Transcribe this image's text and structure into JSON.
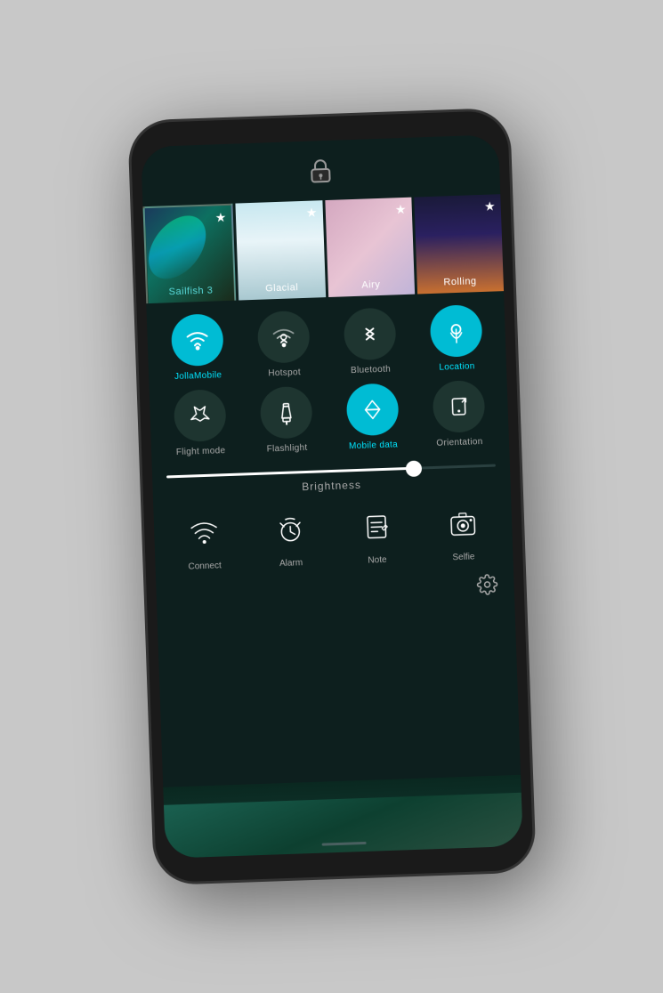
{
  "phone": {
    "lock_icon": "🔒"
  },
  "wallpapers": [
    {
      "label": "Sailfish 3",
      "active": true,
      "starred": true,
      "type": "sailfish"
    },
    {
      "label": "Glacial",
      "active": false,
      "starred": true,
      "type": "glacial"
    },
    {
      "label": "Airy",
      "active": false,
      "starred": true,
      "type": "airy"
    },
    {
      "label": "Rolling",
      "active": false,
      "starred": true,
      "type": "rolling"
    }
  ],
  "quick_toggles": [
    {
      "id": "wifi",
      "label": "JollaMobile",
      "active": true
    },
    {
      "id": "hotspot",
      "label": "Hotspot",
      "active": false
    },
    {
      "id": "bluetooth",
      "label": "Bluetooth",
      "active": false
    },
    {
      "id": "location",
      "label": "Location",
      "active": true
    },
    {
      "id": "flight",
      "label": "Flight mode",
      "active": false
    },
    {
      "id": "flashlight",
      "label": "Flashlight",
      "active": false
    },
    {
      "id": "mobiledata",
      "label": "Mobile data",
      "active": true
    },
    {
      "id": "orientation",
      "label": "Orientation",
      "active": false
    }
  ],
  "brightness": {
    "label": "Brightness",
    "value": 75
  },
  "app_shortcuts": [
    {
      "id": "connect",
      "label": "Connect"
    },
    {
      "id": "alarm",
      "label": "Alarm"
    },
    {
      "id": "note",
      "label": "Note"
    },
    {
      "id": "selfie",
      "label": "Selfie"
    }
  ],
  "settings": {
    "icon_label": "Settings"
  }
}
